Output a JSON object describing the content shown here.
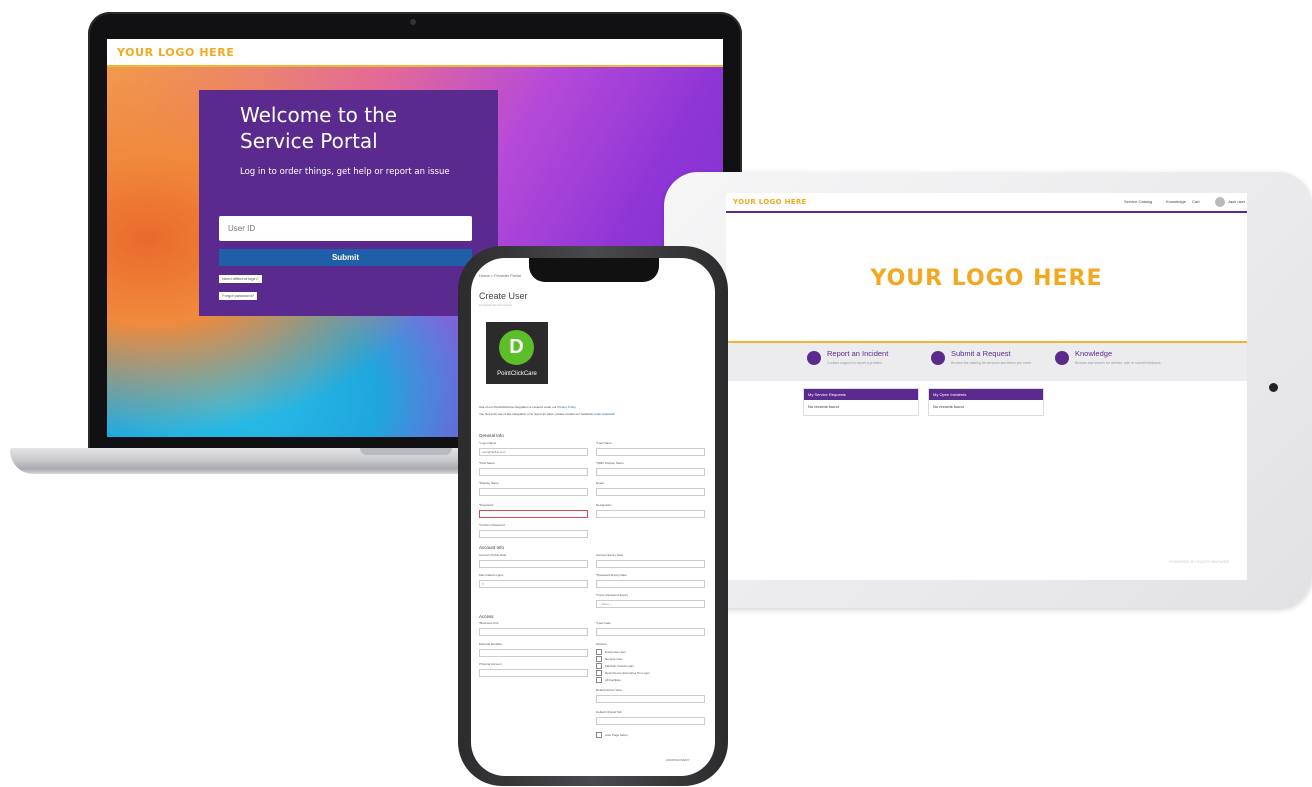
{
  "laptop": {
    "logo": "YOUR LOGO HERE",
    "title": "Welcome to the Service Portal",
    "subtitle": "Log in to order things, get help or report an issue",
    "user_id_placeholder": "User ID",
    "submit_label": "Submit",
    "link_1": "Need different login?",
    "link_2": "Forgot password?"
  },
  "tablet": {
    "logo_small": "YOUR LOGO HERE",
    "nav": [
      "Service Catalog",
      "Knowledge",
      "Cart",
      "Jack user"
    ],
    "big_logo": "YOUR LOGO HERE",
    "cards": [
      {
        "title": "Report an Incident",
        "desc": "Contact support to report a problem"
      },
      {
        "title": "Submit a Request",
        "desc": "Browse the catalog for services and items you need"
      },
      {
        "title": "Knowledge",
        "desc": "Browse and search for articles, rate or submit feedback"
      }
    ],
    "boxes": [
      {
        "head": "My Service Requests",
        "body": "No records found"
      },
      {
        "head": "My Open Incidents",
        "body": "No records found"
      }
    ],
    "powered_by": "POWERED BY EQUITYANSWER"
  },
  "phone": {
    "breadcrumb": "Home  >  Provider Portal",
    "title": "Create User",
    "subtitle": "Complete the form below",
    "logo_text": "PointClickCare",
    "info_1": "Use of our PointClickCare integration is covered under our",
    "info_1_link": "Privacy Policy",
    "info_2": "You find such use of this integration or to report an issue, please contact our helpdesk",
    "info_2_link": "under Helpdesk",
    "sections": {
      "general": "General Info",
      "account": "Account Info",
      "access": "Access"
    },
    "labels": {
      "login_name": "*Login Name",
      "last_name": "*Last Name",
      "first_name": "*First Name",
      "mmc_display": "*MMC Display Name",
      "display_name": "*Display Name",
      "email": "Email",
      "password": "*Password",
      "designation": "Designation",
      "confirm_password": "*Confirm Password",
      "account_profile": "Account Profile Date",
      "account_expiry": "Account Expiry Date",
      "max_failed": "Max Failed Logins",
      "password_expiry": "*Password Expiry Date",
      "force_reset": "*Force Password Expiry",
      "business_unit": "*Business Unit",
      "last_code": "*Last Code",
      "external_identifier": "External Identifier",
      "options": "Options",
      "physical_account": "Physical Account",
      "default_admin_view": "Default Admin View",
      "default_clinical_tab": "Default Clinical Tab"
    },
    "login_placeholder": "user@facility.com",
    "max_failed_value": "5",
    "force_reset_value": "-- None --",
    "options": [
      "Enterprise User",
      "Remote User",
      "Maintain Virtual Login",
      "Restricted to Enterprise Pin Login",
      "All Facilities"
    ],
    "auto_page_setup": "Auto Page Setup",
    "footer": "ASKDISCOVERY"
  }
}
